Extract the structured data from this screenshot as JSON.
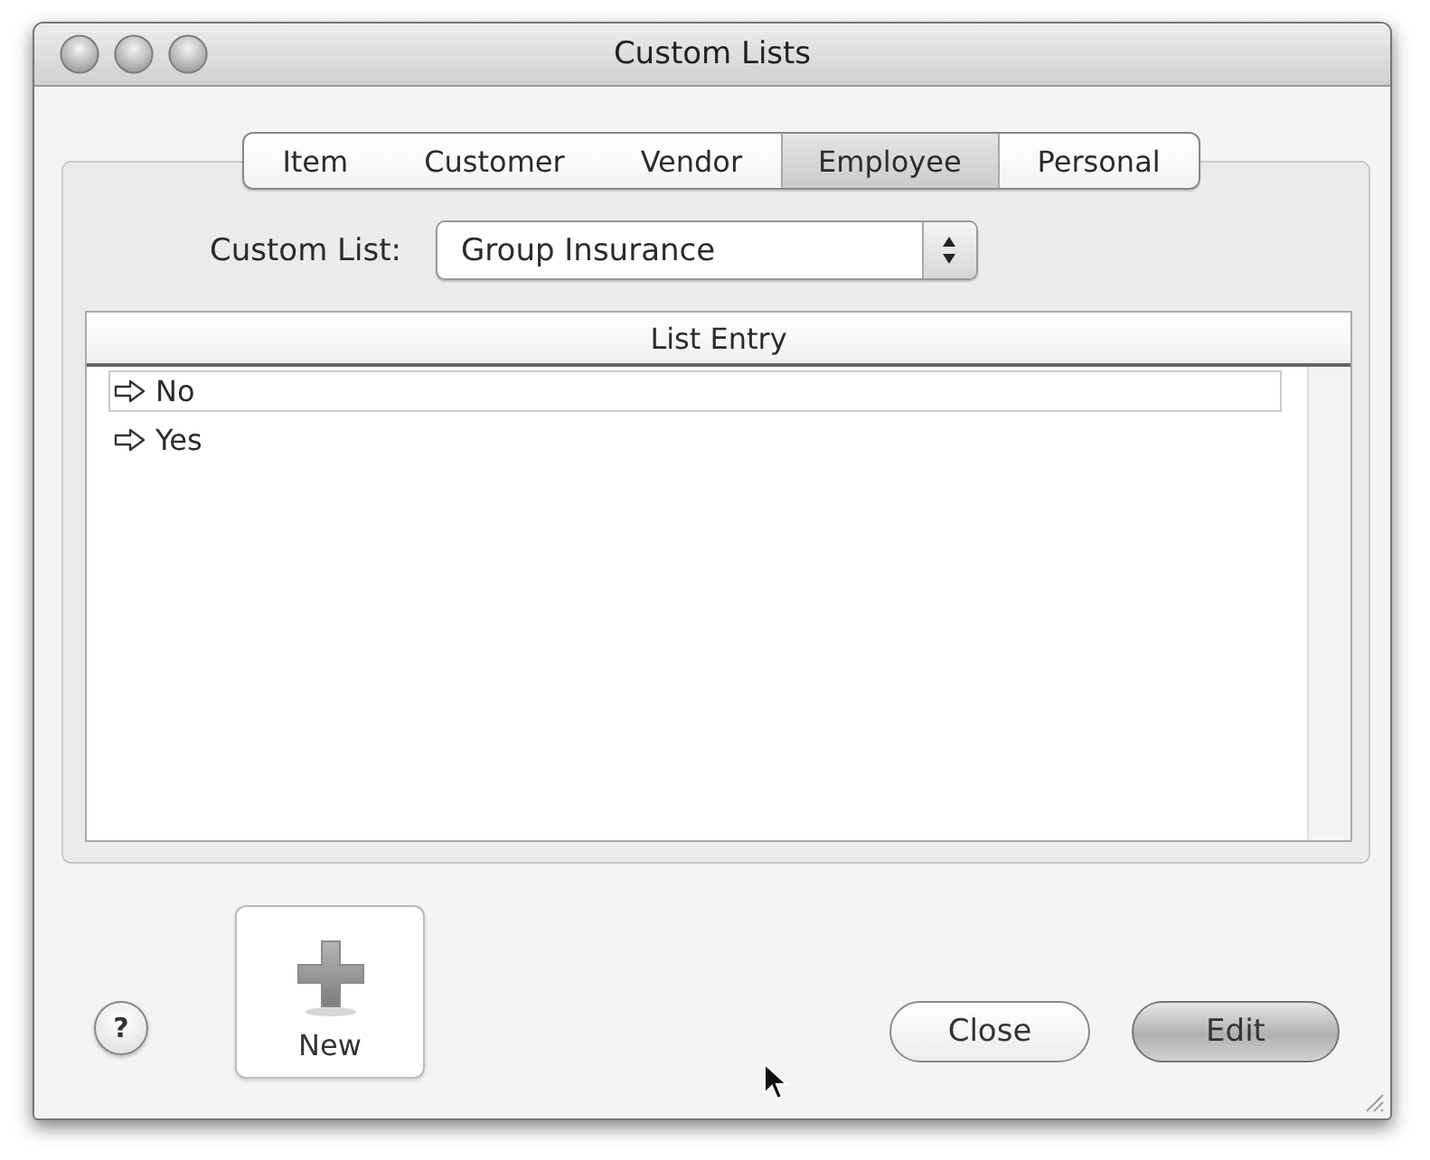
{
  "window": {
    "title": "Custom Lists"
  },
  "tabs": [
    {
      "label": "Item",
      "selected": false
    },
    {
      "label": "Customer",
      "selected": false
    },
    {
      "label": "Vendor",
      "selected": false
    },
    {
      "label": "Employee",
      "selected": true
    },
    {
      "label": "Personal",
      "selected": false
    }
  ],
  "custom_list": {
    "label": "Custom List:",
    "value": "Group Insurance"
  },
  "table": {
    "columns": [
      "List Entry"
    ],
    "rows": [
      {
        "entry": "No",
        "selected": true
      },
      {
        "entry": "Yes",
        "selected": false
      }
    ]
  },
  "help_button": {
    "label": "?"
  },
  "new_button": {
    "label": "New"
  },
  "buttons": [
    {
      "label": "Close",
      "default": false
    },
    {
      "label": "Edit",
      "default": true
    }
  ]
}
